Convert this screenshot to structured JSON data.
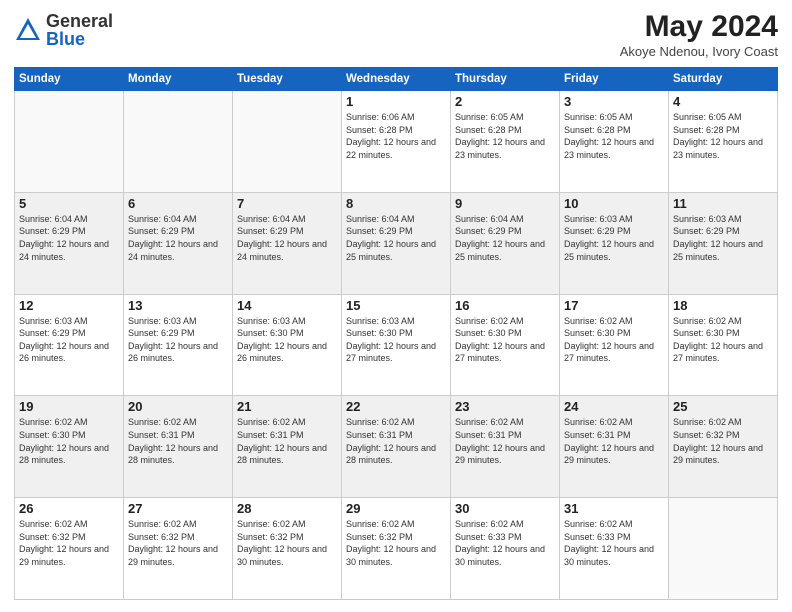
{
  "header": {
    "logo_general": "General",
    "logo_blue": "Blue",
    "month_year": "May 2024",
    "location": "Akoye Ndenou, Ivory Coast"
  },
  "days_of_week": [
    "Sunday",
    "Monday",
    "Tuesday",
    "Wednesday",
    "Thursday",
    "Friday",
    "Saturday"
  ],
  "weeks": [
    [
      {
        "day": "",
        "info": ""
      },
      {
        "day": "",
        "info": ""
      },
      {
        "day": "",
        "info": ""
      },
      {
        "day": "1",
        "info": "Sunrise: 6:06 AM\nSunset: 6:28 PM\nDaylight: 12 hours\nand 22 minutes."
      },
      {
        "day": "2",
        "info": "Sunrise: 6:05 AM\nSunset: 6:28 PM\nDaylight: 12 hours\nand 23 minutes."
      },
      {
        "day": "3",
        "info": "Sunrise: 6:05 AM\nSunset: 6:28 PM\nDaylight: 12 hours\nand 23 minutes."
      },
      {
        "day": "4",
        "info": "Sunrise: 6:05 AM\nSunset: 6:28 PM\nDaylight: 12 hours\nand 23 minutes."
      }
    ],
    [
      {
        "day": "5",
        "info": "Sunrise: 6:04 AM\nSunset: 6:29 PM\nDaylight: 12 hours\nand 24 minutes."
      },
      {
        "day": "6",
        "info": "Sunrise: 6:04 AM\nSunset: 6:29 PM\nDaylight: 12 hours\nand 24 minutes."
      },
      {
        "day": "7",
        "info": "Sunrise: 6:04 AM\nSunset: 6:29 PM\nDaylight: 12 hours\nand 24 minutes."
      },
      {
        "day": "8",
        "info": "Sunrise: 6:04 AM\nSunset: 6:29 PM\nDaylight: 12 hours\nand 25 minutes."
      },
      {
        "day": "9",
        "info": "Sunrise: 6:04 AM\nSunset: 6:29 PM\nDaylight: 12 hours\nand 25 minutes."
      },
      {
        "day": "10",
        "info": "Sunrise: 6:03 AM\nSunset: 6:29 PM\nDaylight: 12 hours\nand 25 minutes."
      },
      {
        "day": "11",
        "info": "Sunrise: 6:03 AM\nSunset: 6:29 PM\nDaylight: 12 hours\nand 25 minutes."
      }
    ],
    [
      {
        "day": "12",
        "info": "Sunrise: 6:03 AM\nSunset: 6:29 PM\nDaylight: 12 hours\nand 26 minutes."
      },
      {
        "day": "13",
        "info": "Sunrise: 6:03 AM\nSunset: 6:29 PM\nDaylight: 12 hours\nand 26 minutes."
      },
      {
        "day": "14",
        "info": "Sunrise: 6:03 AM\nSunset: 6:30 PM\nDaylight: 12 hours\nand 26 minutes."
      },
      {
        "day": "15",
        "info": "Sunrise: 6:03 AM\nSunset: 6:30 PM\nDaylight: 12 hours\nand 27 minutes."
      },
      {
        "day": "16",
        "info": "Sunrise: 6:02 AM\nSunset: 6:30 PM\nDaylight: 12 hours\nand 27 minutes."
      },
      {
        "day": "17",
        "info": "Sunrise: 6:02 AM\nSunset: 6:30 PM\nDaylight: 12 hours\nand 27 minutes."
      },
      {
        "day": "18",
        "info": "Sunrise: 6:02 AM\nSunset: 6:30 PM\nDaylight: 12 hours\nand 27 minutes."
      }
    ],
    [
      {
        "day": "19",
        "info": "Sunrise: 6:02 AM\nSunset: 6:30 PM\nDaylight: 12 hours\nand 28 minutes."
      },
      {
        "day": "20",
        "info": "Sunrise: 6:02 AM\nSunset: 6:31 PM\nDaylight: 12 hours\nand 28 minutes."
      },
      {
        "day": "21",
        "info": "Sunrise: 6:02 AM\nSunset: 6:31 PM\nDaylight: 12 hours\nand 28 minutes."
      },
      {
        "day": "22",
        "info": "Sunrise: 6:02 AM\nSunset: 6:31 PM\nDaylight: 12 hours\nand 28 minutes."
      },
      {
        "day": "23",
        "info": "Sunrise: 6:02 AM\nSunset: 6:31 PM\nDaylight: 12 hours\nand 29 minutes."
      },
      {
        "day": "24",
        "info": "Sunrise: 6:02 AM\nSunset: 6:31 PM\nDaylight: 12 hours\nand 29 minutes."
      },
      {
        "day": "25",
        "info": "Sunrise: 6:02 AM\nSunset: 6:32 PM\nDaylight: 12 hours\nand 29 minutes."
      }
    ],
    [
      {
        "day": "26",
        "info": "Sunrise: 6:02 AM\nSunset: 6:32 PM\nDaylight: 12 hours\nand 29 minutes."
      },
      {
        "day": "27",
        "info": "Sunrise: 6:02 AM\nSunset: 6:32 PM\nDaylight: 12 hours\nand 29 minutes."
      },
      {
        "day": "28",
        "info": "Sunrise: 6:02 AM\nSunset: 6:32 PM\nDaylight: 12 hours\nand 30 minutes."
      },
      {
        "day": "29",
        "info": "Sunrise: 6:02 AM\nSunset: 6:32 PM\nDaylight: 12 hours\nand 30 minutes."
      },
      {
        "day": "30",
        "info": "Sunrise: 6:02 AM\nSunset: 6:33 PM\nDaylight: 12 hours\nand 30 minutes."
      },
      {
        "day": "31",
        "info": "Sunrise: 6:02 AM\nSunset: 6:33 PM\nDaylight: 12 hours\nand 30 minutes."
      },
      {
        "day": "",
        "info": ""
      }
    ]
  ]
}
